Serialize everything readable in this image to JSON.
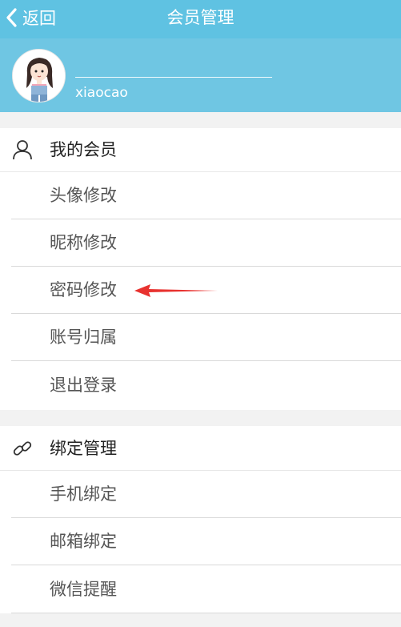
{
  "nav": {
    "back_label": "返回",
    "title": "会员管理"
  },
  "profile": {
    "username": "xiaocao"
  },
  "section_member": {
    "header": "我的会员",
    "items": [
      "头像修改",
      "昵称修改",
      "密码修改",
      "账号归属",
      "退出登录"
    ]
  },
  "section_binding": {
    "header": "绑定管理",
    "items": [
      "手机绑定",
      "邮箱绑定",
      "微信提醒"
    ]
  },
  "colors": {
    "nav_bg": "#5fc2e2",
    "profile_bg": "#6fc6e3",
    "annotation_arrow": "#e8322f"
  },
  "icons": {
    "back": "chevron-left-icon",
    "member": "user-icon",
    "binding": "link-icon"
  }
}
